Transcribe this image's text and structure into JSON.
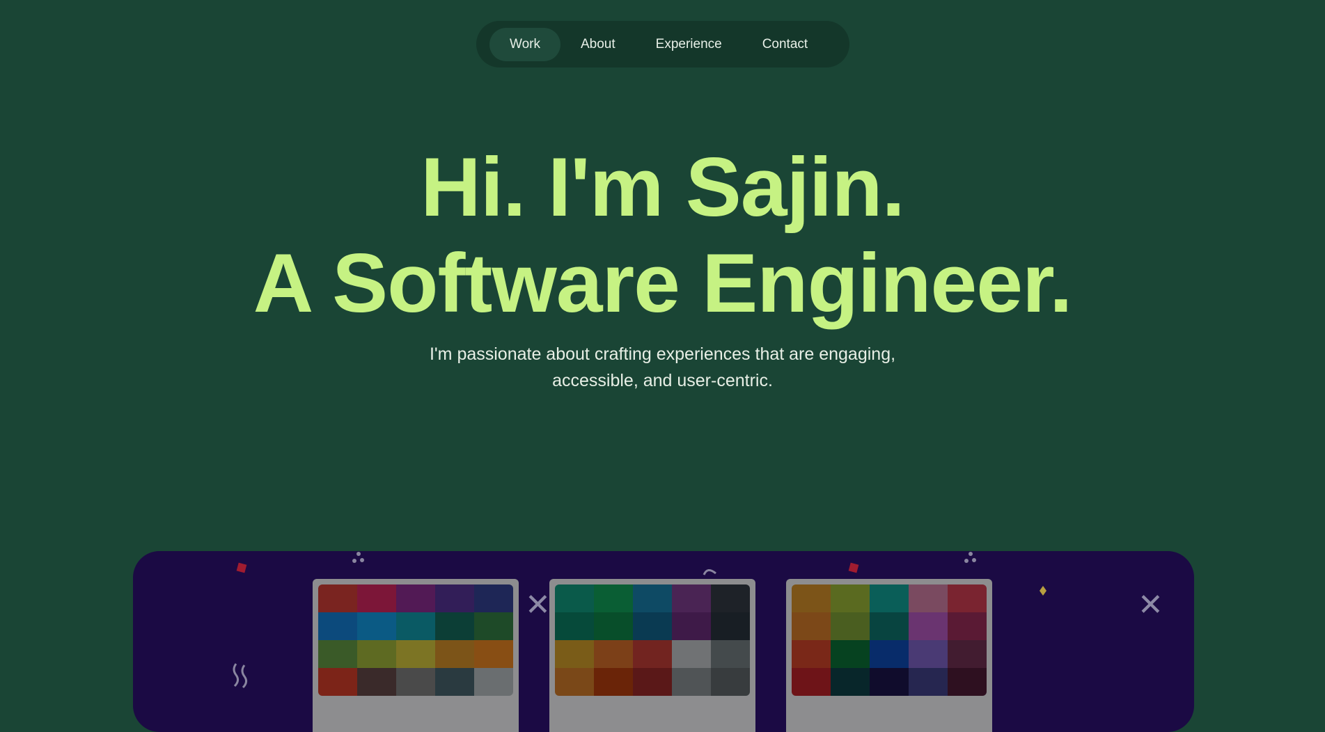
{
  "nav": {
    "items": [
      {
        "label": "Work",
        "active": true
      },
      {
        "label": "About",
        "active": false
      },
      {
        "label": "Experience",
        "active": false
      },
      {
        "label": "Contact",
        "active": false
      }
    ]
  },
  "hero": {
    "line1": "Hi. I'm Sajin.",
    "line2": "A Software Engineer.",
    "subtitle_line1": "I'm passionate about crafting experiences that are engaging,",
    "subtitle_line2": "accessible, and user-centric."
  },
  "colors": {
    "background": "#1a4535",
    "nav_bg": "#14372a",
    "accent": "#c6f283",
    "showcase_bg": "#1b0a44"
  },
  "palettes": [
    [
      "#7a2420",
      "#7c1638",
      "#521a55",
      "#321e58",
      "#1e2656",
      "#0c4a7c",
      "#0b5a84",
      "#0a5a64",
      "#0c3e36",
      "#1e4a28",
      "#3a5a28",
      "#5e6a22",
      "#7c7424",
      "#7c5418",
      "#884e14",
      "#7c2418",
      "#3a2a2a",
      "#4a4a4a",
      "#2a3a40",
      "#6a6e70"
    ],
    [
      "#0a5a4a",
      "#0a5e34",
      "#0e4a64",
      "#4a2454",
      "#1e2228",
      "#064a3a",
      "#084e2a",
      "#0a3a52",
      "#3e1a48",
      "#181e24",
      "#7a5c18",
      "#7c4018",
      "#722420",
      "#707274",
      "#444a4c",
      "#7a4818",
      "#6a2408",
      "#5a1818",
      "#505456",
      "#383c3e"
    ],
    [
      "#7c5418",
      "#5a6a20",
      "#0a5e58",
      "#7a4a60",
      "#7a2430",
      "#7c4818",
      "#4a5e20",
      "#084440",
      "#6a3470",
      "#5a1a34",
      "#7a2818",
      "#064220",
      "#082c6a",
      "#4a3a74",
      "#421c30",
      "#6e1418",
      "#08262a",
      "#100c2c",
      "#262650",
      "#2e1020"
    ]
  ]
}
